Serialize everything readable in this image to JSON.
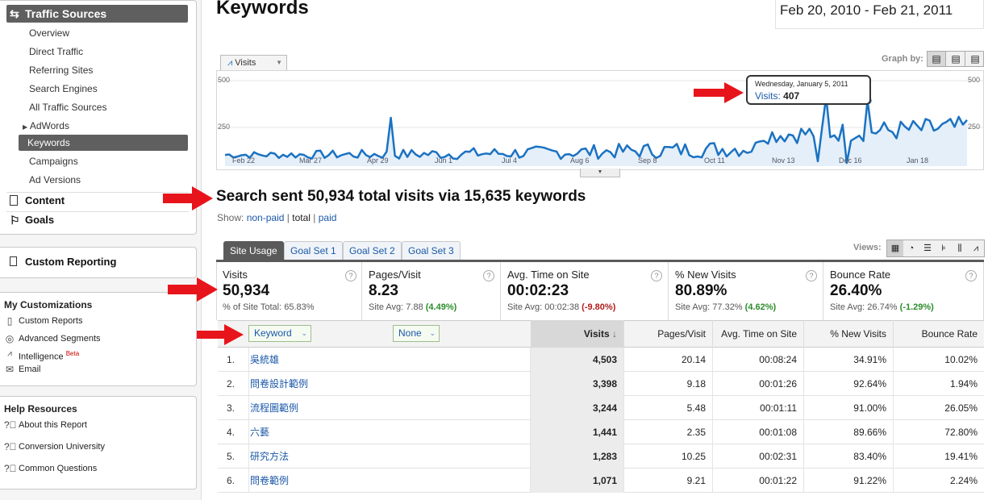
{
  "sidebar": {
    "traffic_sources": "Traffic Sources",
    "items": [
      "Overview",
      "Direct Traffic",
      "Referring Sites",
      "Search Engines",
      "All Traffic Sources",
      "AdWords",
      "Keywords",
      "Campaigns",
      "Ad Versions"
    ],
    "content": "Content",
    "goals": "Goals",
    "custom_reporting": "Custom Reporting",
    "my_customizations": "My Customizations",
    "custom_reports": "Custom Reports",
    "advanced_segments": "Advanced Segments",
    "intelligence": "Intelligence",
    "beta": "Beta",
    "email": "Email",
    "help_resources": "Help Resources",
    "about_report": "About this Report",
    "conversion_university": "Conversion University",
    "common_questions": "Common Questions"
  },
  "header": {
    "title": "Keywords",
    "date_range": "Feb 20, 2010 - Feb 21, 2011"
  },
  "graph": {
    "metric_button": "Visits",
    "graph_by": "Graph by:",
    "y_left_top": "500",
    "y_left_mid": "250",
    "y_right_top": "500",
    "y_right_mid": "250",
    "x_labels": [
      "Feb 22",
      "Mar 27",
      "Apr 29",
      "Jun 1",
      "Jul 4",
      "Aug 6",
      "Sep 8",
      "Oct 11",
      "Nov 13",
      "Dec 16",
      "Jan 18"
    ],
    "tooltip_date": "Wednesday, January 5, 2011",
    "tooltip_label": "Visits:",
    "tooltip_value": "407",
    "line_color": "#1b72c2"
  },
  "summary": {
    "headline": "Search sent 50,934 total visits via 15,635 keywords",
    "show": "Show:",
    "non_paid": "non-paid",
    "sep1": "|",
    "total": "total",
    "sep2": "|",
    "paid": "paid"
  },
  "tabs": [
    "Site Usage",
    "Goal Set 1",
    "Goal Set 2",
    "Goal Set 3"
  ],
  "views_label": "Views:",
  "metrics": [
    {
      "label": "Visits",
      "value": "50,934",
      "sub": "% of Site Total: 65.83%",
      "avg": "",
      "change": ""
    },
    {
      "label": "Pages/Visit",
      "value": "8.23",
      "sub": "Site Avg:",
      "avg": "7.88",
      "change": "(4.49%)"
    },
    {
      "label": "Avg. Time on Site",
      "value": "00:02:23",
      "sub": "Site Avg:",
      "avg": "00:02:38",
      "change": "(-9.80%)"
    },
    {
      "label": "% New Visits",
      "value": "80.89%",
      "sub": "Site Avg:",
      "avg": "77.32%",
      "change": "(4.62%)"
    },
    {
      "label": "Bounce Rate",
      "value": "26.40%",
      "sub": "Site Avg:",
      "avg": "26.74%",
      "change": "(-1.29%)"
    }
  ],
  "table": {
    "dim1": "Keyword",
    "dim2": "None",
    "columns": [
      "Visits",
      "Pages/Visit",
      "Avg. Time on Site",
      "% New Visits",
      "Bounce Rate"
    ],
    "rows": [
      {
        "n": "1.",
        "kw": "吳統雄",
        "visits": "4,503",
        "ppv": "20.14",
        "time": "00:08:24",
        "new": "34.91%",
        "bounce": "10.02%"
      },
      {
        "n": "2.",
        "kw": "問卷設計範例",
        "visits": "3,398",
        "ppv": "9.18",
        "time": "00:01:26",
        "new": "92.64%",
        "bounce": "1.94%"
      },
      {
        "n": "3.",
        "kw": "流程圖範例",
        "visits": "3,244",
        "ppv": "5.48",
        "time": "00:01:11",
        "new": "91.00%",
        "bounce": "26.05%"
      },
      {
        "n": "4.",
        "kw": "六藝",
        "visits": "1,441",
        "ppv": "2.35",
        "time": "00:01:08",
        "new": "89.66%",
        "bounce": "72.80%"
      },
      {
        "n": "5.",
        "kw": "研究方法",
        "visits": "1,283",
        "ppv": "10.25",
        "time": "00:02:31",
        "new": "83.40%",
        "bounce": "19.41%"
      },
      {
        "n": "6.",
        "kw": "問卷範例",
        "visits": "1,071",
        "ppv": "9.21",
        "time": "00:01:22",
        "new": "91.22%",
        "bounce": "2.24%"
      }
    ]
  }
}
